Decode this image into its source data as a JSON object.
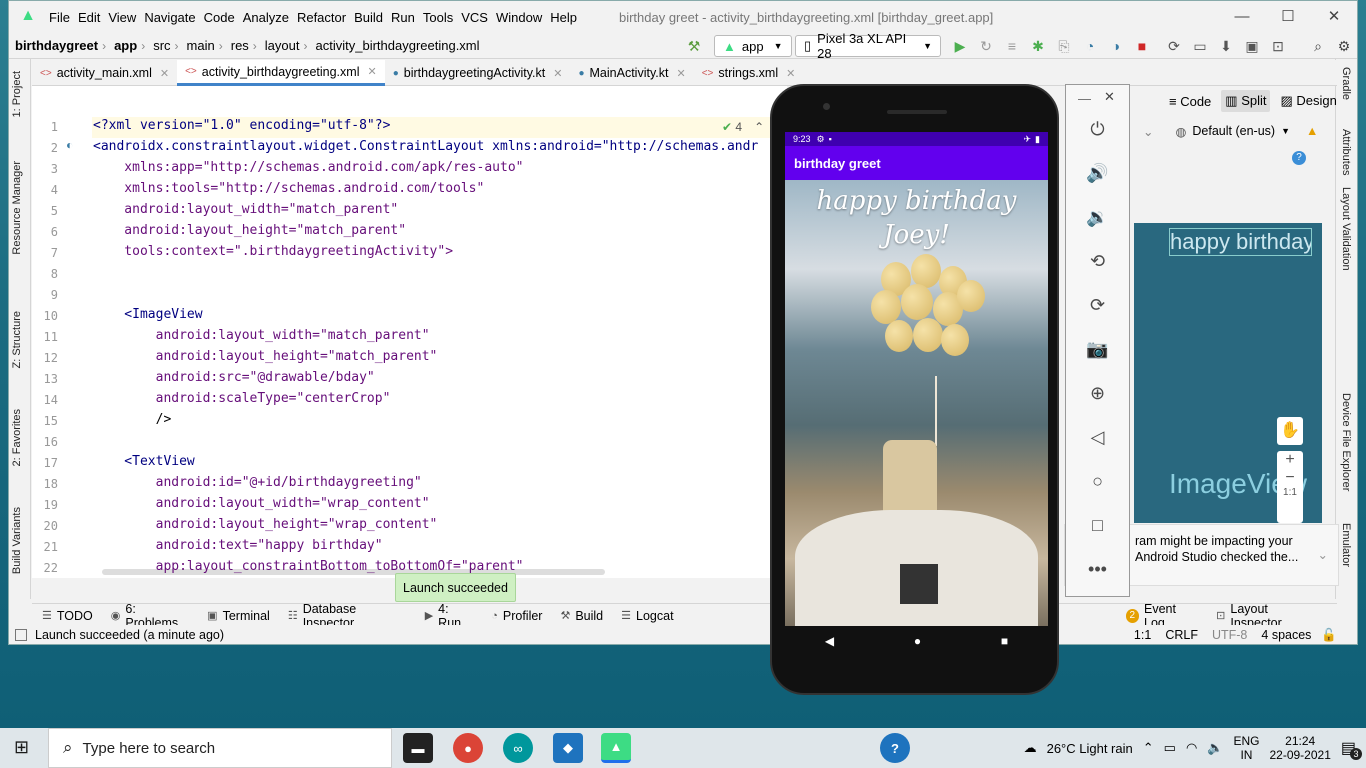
{
  "window": {
    "title": "birthday greet - activity_birthdaygreeting.xml [birthday_greet.app]",
    "menu": [
      "File",
      "Edit",
      "View",
      "Navigate",
      "Code",
      "Analyze",
      "Refactor",
      "Build",
      "Run",
      "Tools",
      "VCS",
      "Window",
      "Help"
    ]
  },
  "breadcrumb": [
    "birthdaygreet",
    "app",
    "src",
    "main",
    "res",
    "layout",
    "activity_birthdaygreeting.xml"
  ],
  "run_config": "app",
  "device_config": "Pixel 3a XL API 28",
  "tabs": [
    "activity_main.xml",
    "activity_birthdaygreeting.xml",
    "birthdaygreetingActivity.kt",
    "MainActivity.kt",
    "strings.xml"
  ],
  "left_tools": [
    "1: Project",
    "Resource Manager",
    "Z: Structure",
    "2: Favorites",
    "Build Variants"
  ],
  "right_tools": [
    "Gradle",
    "Attributes",
    "Layout Validation",
    "Device File Explorer",
    "Emulator"
  ],
  "editor": {
    "inspection_count": "4",
    "lines": [
      {
        "n": "1",
        "t": "<?xml version=\"1.0\" encoding=\"utf-8\"?>"
      },
      {
        "n": "2",
        "t": "<androidx.constraintlayout.widget.ConstraintLayout xmlns:android=\"http://schemas.andr"
      },
      {
        "n": "3",
        "t": "    xmlns:app=\"http://schemas.android.com/apk/res-auto\""
      },
      {
        "n": "4",
        "t": "    xmlns:tools=\"http://schemas.android.com/tools\""
      },
      {
        "n": "5",
        "t": "    android:layout_width=\"match_parent\""
      },
      {
        "n": "6",
        "t": "    android:layout_height=\"match_parent\""
      },
      {
        "n": "7",
        "t": "    tools:context=\".birthdaygreetingActivity\">"
      },
      {
        "n": "8",
        "t": ""
      },
      {
        "n": "9",
        "t": ""
      },
      {
        "n": "10",
        "t": "    <ImageView"
      },
      {
        "n": "11",
        "t": "        android:layout_width=\"match_parent\""
      },
      {
        "n": "12",
        "t": "        android:layout_height=\"match_parent\""
      },
      {
        "n": "13",
        "t": "        android:src=\"@drawable/bday\""
      },
      {
        "n": "14",
        "t": "        android:scaleType=\"centerCrop\""
      },
      {
        "n": "15",
        "t": "        />"
      },
      {
        "n": "16",
        "t": ""
      },
      {
        "n": "17",
        "t": "    <TextView"
      },
      {
        "n": "18",
        "t": "        android:id=\"@+id/birthdaygreeting\""
      },
      {
        "n": "19",
        "t": "        android:layout_width=\"wrap_content\""
      },
      {
        "n": "20",
        "t": "        android:layout_height=\"wrap_content\""
      },
      {
        "n": "21",
        "t": "        android:text=\"happy birthday\""
      },
      {
        "n": "22",
        "t": "        app:layout_constraintBottom_toBottomOf=\"parent\""
      }
    ]
  },
  "view_modes": {
    "code": "Code",
    "split": "Split",
    "design": "Design"
  },
  "design": {
    "locale": "Default (en-us)",
    "preview_text": "happy birthday",
    "preview_label": "ImageView",
    "zoom_label": "1:1"
  },
  "notification": {
    "line1": "ram might be impacting your",
    "line2": "Android Studio checked the..."
  },
  "toast": "Launch succeeded",
  "bottom_tools": [
    "TODO",
    "6: Problems",
    "Terminal",
    "Database Inspector",
    "4: Run",
    "Profiler",
    "Build",
    "Logcat"
  ],
  "bottom_right": {
    "event_log_count": "2",
    "event_log": "Event Log",
    "layout_inspector": "Layout Inspector"
  },
  "status": {
    "message": "Launch succeeded (a minute ago)",
    "position": "1:1",
    "line_sep": "CRLF",
    "encoding": "UTF-8",
    "indent": "4 spaces"
  },
  "phone": {
    "time": "9:23",
    "app_title": "birthday greet",
    "greeting_line1": "happy birthday",
    "greeting_line2": "Joey!"
  },
  "taskbar": {
    "search_placeholder": "Type here to search",
    "weather": "26°C  Light rain",
    "lang1": "ENG",
    "lang2": "IN",
    "time": "21:24",
    "date": "22-09-2021",
    "notif_count": "3"
  }
}
